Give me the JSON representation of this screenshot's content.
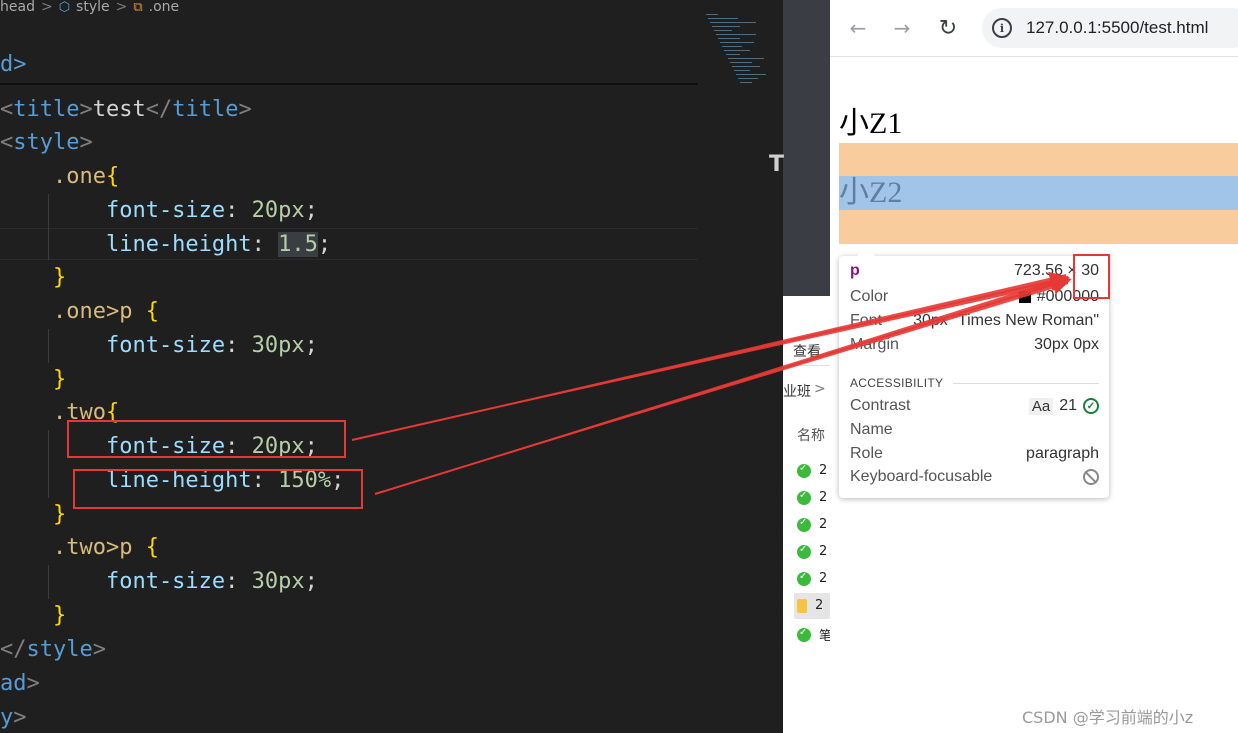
{
  "editor": {
    "breadcrumb": {
      "items": [
        "head",
        "style",
        ".one"
      ],
      "separator": ">"
    },
    "lines": [
      {
        "parts": [
          [
            "tag",
            "d>"
          ]
        ]
      },
      {
        "parts": [
          [
            "punct",
            "<"
          ],
          [
            "tag",
            "title"
          ],
          [
            "punct",
            ">"
          ],
          [
            "text",
            "test"
          ],
          [
            "punct",
            "</"
          ],
          [
            "tag",
            "title"
          ],
          [
            "punct",
            ">"
          ]
        ]
      },
      {
        "parts": [
          [
            "punct",
            "<"
          ],
          [
            "tag",
            "style"
          ],
          [
            "punct",
            ">"
          ]
        ]
      },
      {
        "parts": [
          [
            "sel",
            "    .one"
          ],
          [
            "brace",
            "{"
          ]
        ]
      },
      {
        "parts": [
          [
            "prop",
            "        font-size"
          ],
          [
            "text",
            ": "
          ],
          [
            "num",
            "20px"
          ],
          [
            "text",
            ";"
          ]
        ]
      },
      {
        "parts": [
          [
            "prop",
            "        line-height"
          ],
          [
            "text",
            ": "
          ],
          [
            "numhl",
            "1.5"
          ],
          [
            "text",
            ";"
          ]
        ]
      },
      {
        "parts": [
          [
            "brace",
            "    }"
          ]
        ]
      },
      {
        "parts": [
          [
            "sel",
            "    .one>p "
          ],
          [
            "brace",
            "{"
          ]
        ]
      },
      {
        "parts": [
          [
            "prop",
            "        font-size"
          ],
          [
            "text",
            ": "
          ],
          [
            "num",
            "30px"
          ],
          [
            "text",
            ";"
          ]
        ]
      },
      {
        "parts": [
          [
            "brace",
            "    }"
          ]
        ]
      },
      {
        "parts": [
          [
            "sel",
            "    .two"
          ],
          [
            "brace",
            "{"
          ]
        ]
      },
      {
        "parts": [
          [
            "prop",
            "        font-size"
          ],
          [
            "text",
            ": "
          ],
          [
            "num",
            "20px"
          ],
          [
            "text",
            ";"
          ]
        ]
      },
      {
        "parts": [
          [
            "prop",
            "        line-height"
          ],
          [
            "text",
            ": "
          ],
          [
            "num",
            "150%"
          ],
          [
            "text",
            ";"
          ]
        ]
      },
      {
        "parts": [
          [
            "brace",
            "    }"
          ]
        ]
      },
      {
        "parts": [
          [
            "sel",
            "    .two>p "
          ],
          [
            "brace",
            "{"
          ]
        ]
      },
      {
        "parts": [
          [
            "prop",
            "        font-size"
          ],
          [
            "text",
            ": "
          ],
          [
            "num",
            "30px"
          ],
          [
            "text",
            ";"
          ]
        ]
      },
      {
        "parts": [
          [
            "brace",
            "    }"
          ]
        ]
      },
      {
        "parts": [
          [
            "punct",
            "</"
          ],
          [
            "tag",
            "style"
          ],
          [
            "punct",
            ">"
          ]
        ]
      },
      {
        "parts": [
          [
            "tag",
            "ad"
          ],
          [
            "punct",
            ">"
          ]
        ]
      },
      {
        "parts": [
          [
            "tag",
            "y"
          ],
          [
            "punct",
            ">"
          ]
        ]
      }
    ]
  },
  "explorer": {
    "view_label": "查看",
    "class_label": "业班",
    "class_chevron": ">",
    "name_header": "名称",
    "rows": [
      "2",
      "2",
      "2",
      "2",
      "2",
      "2",
      "笔"
    ],
    "cut_char": "T"
  },
  "browser": {
    "url": "127.0.0.1:5500/test.html",
    "page": {
      "p1": "小Z1",
      "p2": "小Z2"
    },
    "tooltip": {
      "tag": "p",
      "size": "723.56 × 30",
      "color_label": "Color",
      "color_value": "#000000",
      "font_label": "Font",
      "font_value": "30px \"Times New Roman\"",
      "margin_label": "Margin",
      "margin_value": "30px 0px",
      "accessibility_heading": "ACCESSIBILITY",
      "contrast_label": "Contrast",
      "contrast_aa": "Aa",
      "contrast_value": "21",
      "name_label": "Name",
      "role_label": "Role",
      "role_value": "paragraph",
      "keyboard_label": "Keyboard-focusable"
    },
    "watermark": "CSDN @学习前端的小z"
  },
  "colors": {
    "annotation_red": "#e53935",
    "margin_orange": "#f9cc9d",
    "content_blue": "#a0c5e8"
  }
}
